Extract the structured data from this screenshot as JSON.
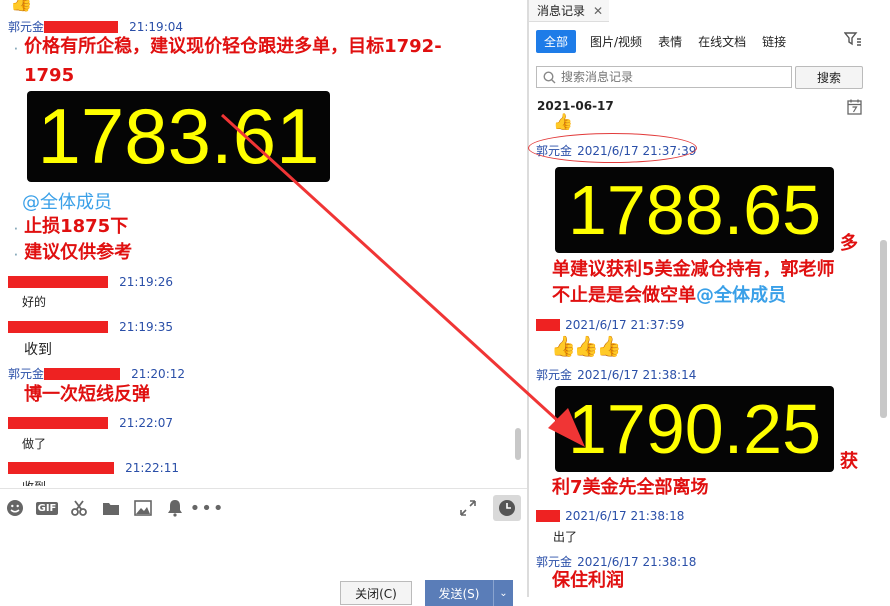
{
  "left": {
    "messages": {
      "m1": {
        "nick": "郭元金",
        "time": "21:19:04"
      },
      "m1_lines": [
        "价格有所企稳，建议现价轻仓跟进多单，目标1792-",
        "1795"
      ],
      "m1_ticker": "1783.61",
      "m1_at": "@全体成员",
      "m1_stop": "止损1875下",
      "m1_note": "建议仅供参考",
      "m2": {
        "time": "21:19:26",
        "text": "好的"
      },
      "m3": {
        "time": "21:19:35",
        "text": "收到"
      },
      "m4": {
        "nick": "郭元金",
        "time": "21:20:12",
        "text": "博一次短线反弹"
      },
      "m5": {
        "time": "21:22:07",
        "text": "做了"
      },
      "m6": {
        "time": "21:22:11",
        "text": "收到"
      }
    },
    "toolbar_icons": [
      "emoji-icon",
      "gif-icon",
      "scissors-icon",
      "folder-icon",
      "image-icon",
      "bell-icon",
      "more-icon"
    ],
    "gif_label": "GIF",
    "close_button": "关闭(C)",
    "send_button": "发送(S)"
  },
  "right": {
    "panel_title": "消息记录",
    "tabs": [
      "全部",
      "图片/视频",
      "表情",
      "在线文档",
      "链接"
    ],
    "search_placeholder": "搜索消息记录",
    "search_button": "搜索",
    "date": "2021-06-17",
    "r1": {
      "nick": "郭元金",
      "time": "2021/6/17 21:37:39",
      "ticker": "1788.65",
      "tail": "多",
      "line2": "单建议获利5美金减仓持有，郭老师",
      "line3": "不止是是会做空单",
      "at": "@全体成员"
    },
    "r2": {
      "time": "2021/6/17 21:37:59"
    },
    "r3": {
      "nick": "郭元金",
      "time": "2021/6/17 21:38:14",
      "ticker": "1790.25",
      "tail": "获",
      "line2": "利7美金先全部离场"
    },
    "r4": {
      "time": "2021/6/17 21:38:18",
      "text": "出了"
    },
    "r5": {
      "nick": "郭元金",
      "time": "2021/6/17 21:38:18",
      "text": "保住利润"
    }
  },
  "colors": {
    "accent": "#1e7ce8",
    "alert_red": "#e01010",
    "ticker_yellow": "#ffff00",
    "link_blue": "#2a4fa8"
  }
}
